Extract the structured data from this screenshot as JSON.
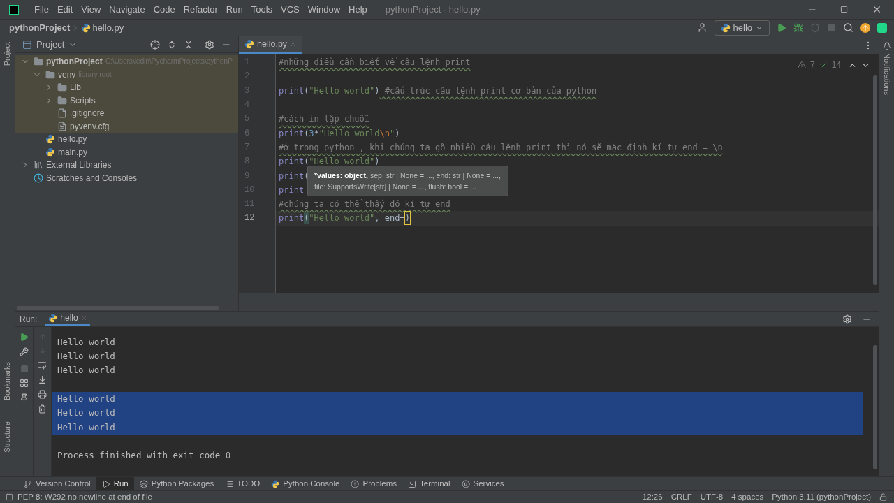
{
  "window": {
    "title": "pythonProject - hello.py"
  },
  "menu": [
    "File",
    "Edit",
    "View",
    "Navigate",
    "Code",
    "Refactor",
    "Run",
    "Tools",
    "VCS",
    "Window",
    "Help"
  ],
  "breadcrumb": {
    "project": "pythonProject",
    "file": "hello.py"
  },
  "run_config": {
    "label": "hello"
  },
  "side_strip": {
    "top": "Project",
    "bottom": [
      "Bookmarks",
      "Structure"
    ],
    "right": "Notifications"
  },
  "project_panel": {
    "title": "Project",
    "tree": [
      {
        "label": "pythonProject",
        "hint": "C:\\Users\\ledin\\PycharmProjects\\pythonP",
        "kind": "folder",
        "expanded": true,
        "highlighted": true,
        "bold": true,
        "children": [
          {
            "label": "venv",
            "hint": "library root",
            "kind": "folder",
            "expanded": true,
            "highlighted": true,
            "children": [
              {
                "label": "Lib",
                "kind": "folder",
                "expanded": false,
                "highlighted": true
              },
              {
                "label": "Scripts",
                "kind": "folder",
                "expanded": false,
                "highlighted": true
              },
              {
                "label": ".gitignore",
                "kind": "ignore",
                "highlighted": true
              },
              {
                "label": "pyvenv.cfg",
                "kind": "text",
                "highlighted": true
              }
            ]
          },
          {
            "label": "hello.py",
            "kind": "python",
            "highlighted": false
          },
          {
            "label": "main.py",
            "kind": "python",
            "highlighted": false
          }
        ]
      },
      {
        "label": "External Libraries",
        "kind": "libraries",
        "expanded": false,
        "highlighted": false
      },
      {
        "label": "Scratches and Consoles",
        "kind": "scratches",
        "highlighted": false
      }
    ]
  },
  "editor": {
    "tab": "hello.py",
    "warnings": "7",
    "checks": "14",
    "lines": [
      {
        "number": "1",
        "current": false,
        "segments": [
          {
            "kind": "comment",
            "text": "#những điều cần biết về câu lệnh print"
          }
        ]
      },
      {
        "number": "2",
        "current": false
      },
      {
        "number": "3",
        "current": false,
        "segments": [
          {
            "kind": "builtin",
            "text": "print"
          },
          {
            "kind": "plain",
            "text": "("
          },
          {
            "kind": "string",
            "text": "\"Hello world\""
          },
          {
            "kind": "plain",
            "text": ")"
          },
          {
            "kind": "comment",
            "text": " #cấu trúc câu lệnh print cơ bản của python"
          }
        ]
      },
      {
        "number": "4",
        "current": false
      },
      {
        "number": "5",
        "current": false,
        "segments": [
          {
            "kind": "comment",
            "text": "#cách in lặp chuỗi"
          }
        ]
      },
      {
        "number": "6",
        "current": false,
        "segments": [
          {
            "kind": "builtin",
            "text": "print"
          },
          {
            "kind": "plain",
            "text": "("
          },
          {
            "kind": "number",
            "text": "3"
          },
          {
            "kind": "plain",
            "text": "*"
          },
          {
            "kind": "string",
            "text": "\"Hello world"
          },
          {
            "kind": "escape",
            "text": "\\n"
          },
          {
            "kind": "string",
            "text": "\""
          },
          {
            "kind": "plain",
            "text": ")"
          }
        ]
      },
      {
        "number": "7",
        "current": false,
        "segments": [
          {
            "kind": "comment",
            "text": "#ở trong python , khi chúng ta gõ nhiều câu lệnh print thì nó sẽ mặc định kí tự end = \\n"
          }
        ]
      },
      {
        "number": "8",
        "current": false,
        "segments": [
          {
            "kind": "builtin",
            "text": "print"
          },
          {
            "kind": "plain",
            "text": "("
          },
          {
            "kind": "string",
            "text": "\"Hello world\""
          },
          {
            "kind": "plain",
            "text": ")"
          }
        ]
      },
      {
        "number": "9",
        "current": false,
        "segments": [
          {
            "kind": "builtin",
            "text": "print"
          },
          {
            "kind": "plain",
            "text": "("
          }
        ]
      },
      {
        "number": "10",
        "current": false,
        "segments": [
          {
            "kind": "builtin",
            "text": "print"
          }
        ]
      },
      {
        "number": "11",
        "current": false,
        "segments": [
          {
            "kind": "comment",
            "text": "#chúng ta có thể thấy đó kí tự end"
          }
        ]
      },
      {
        "number": "12",
        "current": true,
        "segments": [
          {
            "kind": "builtin",
            "text": "print"
          },
          {
            "kind": "brace",
            "text": "("
          },
          {
            "kind": "string",
            "text": "\"Hello world\""
          },
          {
            "kind": "plain",
            "text": ", end="
          },
          {
            "kind": "caret",
            "text": ")"
          }
        ]
      }
    ],
    "tooltip": {
      "bold": "*values: object,",
      "rest": " sep: str | None = ..., end: str | None = ...,",
      "line2": "file: SupportsWrite[str] | None = ..., flush: bool = ..."
    }
  },
  "run_panel": {
    "label": "Run:",
    "tab": "hello",
    "output": [
      {
        "kind": "text",
        "text": "Hello world",
        "selected": false
      },
      {
        "kind": "text",
        "text": "Hello world",
        "selected": false
      },
      {
        "kind": "text",
        "text": "Hello world",
        "selected": false
      },
      {
        "kind": "blank"
      },
      {
        "kind": "text",
        "text": "Hello world",
        "selected": true
      },
      {
        "kind": "text",
        "text": "Hello world",
        "selected": true
      },
      {
        "kind": "text",
        "text": "Hello world",
        "selected": true
      },
      {
        "kind": "blank"
      },
      {
        "kind": "text",
        "text": "Process finished with exit code 0",
        "selected": false
      }
    ]
  },
  "tool_tabs": [
    {
      "label": "Version Control",
      "kind": "branch",
      "selected": false
    },
    {
      "label": "Run",
      "kind": "play",
      "selected": true
    },
    {
      "label": "Python Packages",
      "kind": "layers",
      "selected": false
    },
    {
      "label": "TODO",
      "kind": "list",
      "selected": false
    },
    {
      "label": "Python Console",
      "kind": "python",
      "selected": false
    },
    {
      "label": "Problems",
      "kind": "alert",
      "selected": false
    },
    {
      "label": "Terminal",
      "kind": "terminal",
      "selected": false
    },
    {
      "label": "Services",
      "kind": "services",
      "selected": false
    }
  ],
  "status_bar": {
    "message": "PEP 8: W292 no newline at end of file",
    "items": [
      "12:26",
      "CRLF",
      "UTF-8",
      "4 spaces",
      "Python 3.11 (pythonProject)"
    ]
  }
}
